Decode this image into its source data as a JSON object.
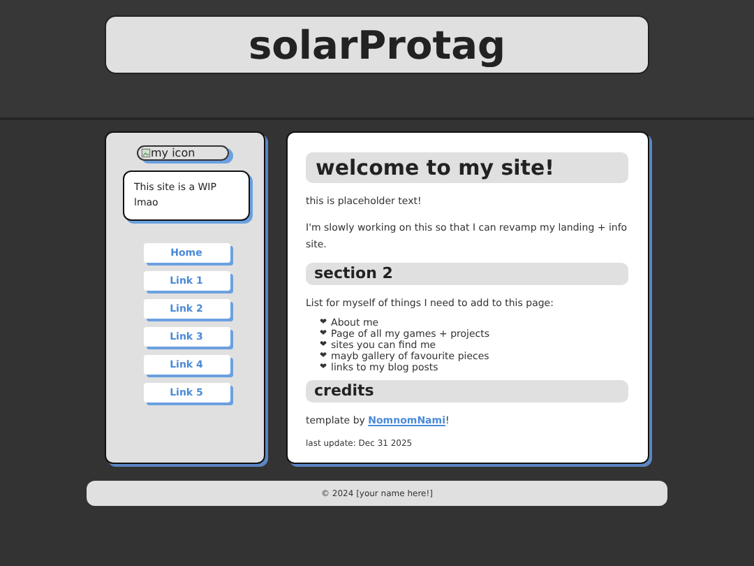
{
  "header": {
    "title": "solarProtag"
  },
  "sidebar": {
    "icon_alt": "my icon",
    "note": "This site is a WIP lmao",
    "links": [
      {
        "label": "Home"
      },
      {
        "label": "Link 1"
      },
      {
        "label": "Link 2"
      },
      {
        "label": "Link 3"
      },
      {
        "label": "Link 4"
      },
      {
        "label": "Link 5"
      }
    ]
  },
  "main": {
    "sections": [
      {
        "heading": "welcome to my site!",
        "kind": "title",
        "paragraphs": [
          "this is placeholder text!",
          "I'm slowly working on this so that I can revamp my landing + info site."
        ]
      },
      {
        "heading": "section 2",
        "kind": "section",
        "paragraphs": [
          "List for myself of things I need to add to this page:"
        ],
        "list": [
          {
            "bullet": "❤",
            "text": "About me"
          },
          {
            "bullet": "❤",
            "text": "Page of all my games + projects"
          },
          {
            "bullet": "❤",
            "text": "sites you can find me"
          },
          {
            "bullet": "❤",
            "text": "mayb gallery of favourite pieces"
          },
          {
            "bullet": "❤",
            "text": "links to my blog posts"
          }
        ]
      },
      {
        "heading": "credits",
        "kind": "section",
        "credit": {
          "prefix": "template by ",
          "link": "NomnomNami",
          "suffix": "!"
        },
        "small": "last update: Dec 31 2025"
      }
    ]
  },
  "footer": {
    "text": "© 2024 [your name here!]"
  }
}
